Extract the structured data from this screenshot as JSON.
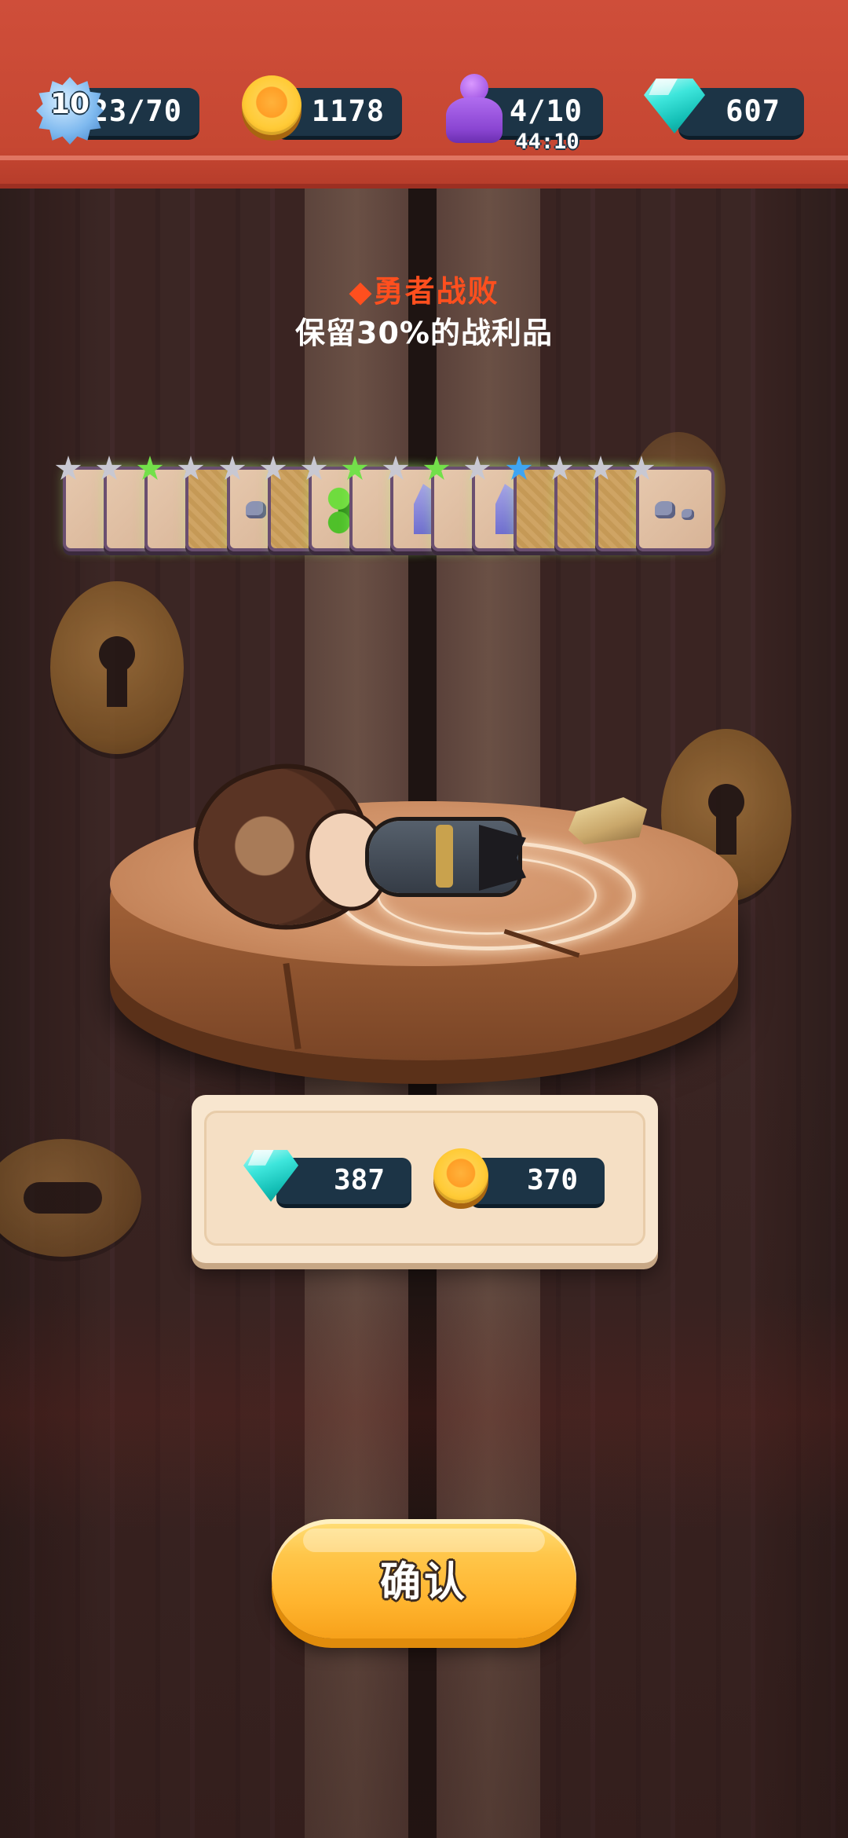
{
  "top_bar": {
    "level": "10",
    "experience": "23/70",
    "coins": "1178",
    "stamina": "4/10",
    "stamina_timer": "44:10",
    "gems": "607"
  },
  "result": {
    "title": "◆勇者战败",
    "subtitle": "保留30%的战利品"
  },
  "loot_cards": [
    {
      "kind": "plain",
      "star": "grey"
    },
    {
      "kind": "plain",
      "star": "grey"
    },
    {
      "kind": "plain",
      "star": "green"
    },
    {
      "kind": "field",
      "star": "grey"
    },
    {
      "kind": "rock",
      "star": "grey"
    },
    {
      "kind": "field",
      "star": "grey"
    },
    {
      "kind": "bush",
      "star": "grey"
    },
    {
      "kind": "plain",
      "star": "green"
    },
    {
      "kind": "crystal",
      "star": "grey"
    },
    {
      "kind": "plain",
      "star": "green"
    },
    {
      "kind": "crystal",
      "star": "grey"
    },
    {
      "kind": "field",
      "star": "blue"
    },
    {
      "kind": "field",
      "star": "grey"
    },
    {
      "kind": "field",
      "star": "grey"
    },
    {
      "kind": "rock",
      "star": "grey"
    }
  ],
  "rewards": {
    "gems": "387",
    "coins": "370"
  },
  "confirm_button": {
    "label": "确认"
  },
  "colors": {
    "top_bar": "#c64732",
    "pill": "#1c3446",
    "title_accent": "#ff4f1e",
    "button": "#ffb42e"
  },
  "icons": {
    "level": "gear-badge-icon",
    "coins": "gold-coin-icon",
    "stamina": "purple-pawn-icon",
    "gems": "cyan-gem-icon"
  }
}
